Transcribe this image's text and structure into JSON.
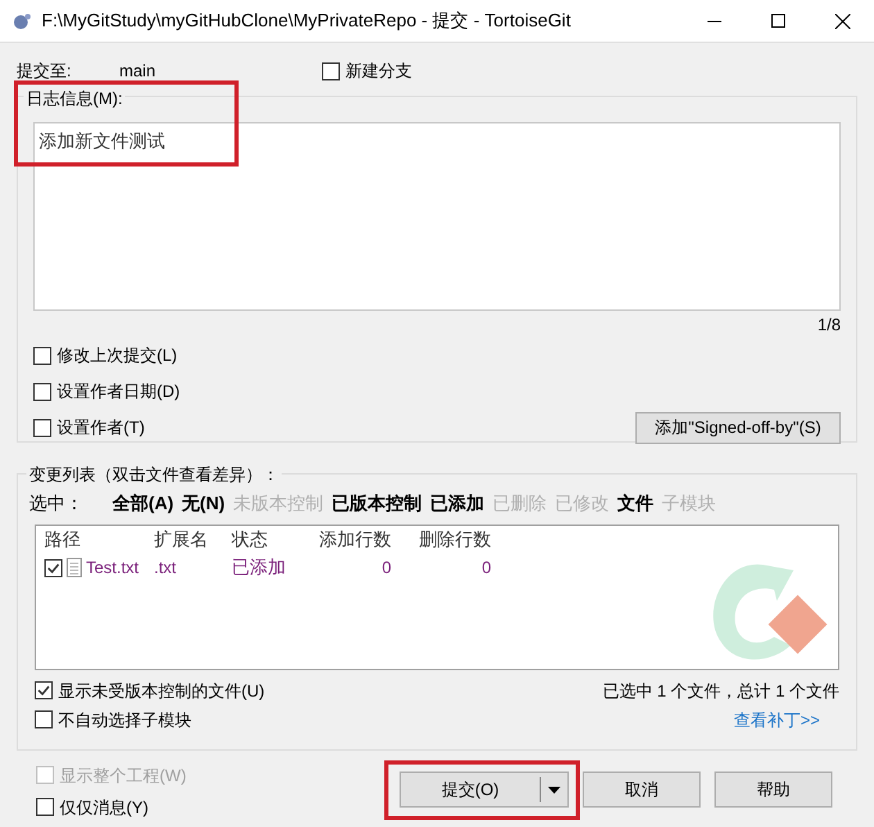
{
  "window": {
    "title": "F:\\MyGitStudy\\myGitHubClone\\MyPrivateRepo - 提交 - TortoiseGit"
  },
  "commit_to": {
    "label": "提交至:",
    "branch": "main"
  },
  "new_branch": {
    "label": "新建分支",
    "checked": false
  },
  "log_message": {
    "label": "日志信息(M):",
    "value": "添加新文件测试",
    "counter": "1/8"
  },
  "options": [
    {
      "label": "修改上次提交(L)",
      "checked": false
    },
    {
      "label": "设置作者日期(D)",
      "checked": false
    },
    {
      "label": "设置作者(T)",
      "checked": false
    }
  ],
  "signed_off_button": "添加\"Signed-off-by\"(S)",
  "changes": {
    "label": "变更列表（双击文件查看差异）：",
    "select_label": "选中：",
    "filters": [
      {
        "label": "全部(A)",
        "enabled": true
      },
      {
        "label": "无(N)",
        "enabled": true
      },
      {
        "label": "未版本控制",
        "enabled": false
      },
      {
        "label": "已版本控制",
        "enabled": true
      },
      {
        "label": "已添加",
        "enabled": true
      },
      {
        "label": "已删除",
        "enabled": false
      },
      {
        "label": "已修改",
        "enabled": false
      },
      {
        "label": "文件",
        "enabled": true
      },
      {
        "label": "子模块",
        "enabled": false
      }
    ],
    "columns": [
      "路径",
      "扩展名",
      "状态",
      "添加行数",
      "删除行数"
    ],
    "rows": [
      {
        "checked": true,
        "path": "Test.txt",
        "extension": ".txt",
        "status": "已添加",
        "added": "0",
        "deleted": "0"
      }
    ],
    "show_unversioned": {
      "label": "显示未受版本控制的文件(U)",
      "checked": true
    },
    "no_auto_submodule": {
      "label": "不自动选择子模块",
      "checked": false
    },
    "summary": "已选中 1 个文件，总计 1 个文件",
    "view_patch": "查看补丁>>"
  },
  "show_whole_project": {
    "label": "显示整个工程(W)",
    "checked": false,
    "disabled": true
  },
  "message_only": {
    "label": "仅仅消息(Y)",
    "checked": false
  },
  "buttons": {
    "commit": "提交(O)",
    "cancel": "取消",
    "help": "帮助"
  }
}
